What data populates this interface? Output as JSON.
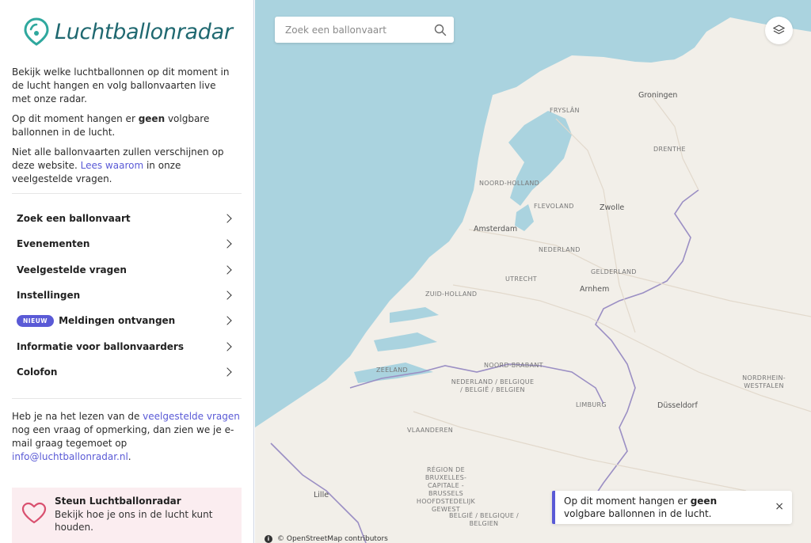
{
  "app": {
    "name": "Luchtballonradar"
  },
  "sidebar": {
    "intro_1": "Bekijk welke luchtballonnen op dit moment in de lucht hangen en volg ballonvaarten live met onze radar.",
    "intro_2_pre": "Op dit moment hangen er ",
    "intro_2_bold": "geen",
    "intro_2_post": " volgbare ballonnen in de lucht.",
    "intro_3_pre": "Niet alle ballonvaarten zullen verschijnen op deze website. ",
    "intro_3_link": "Lees waarom",
    "intro_3_post": " in onze veelgestelde vragen.",
    "menu": [
      {
        "label": "Zoek een ballonvaart"
      },
      {
        "label": "Evenementen"
      },
      {
        "label": "Veelgestelde vragen"
      },
      {
        "label": "Instellingen"
      },
      {
        "label": "Meldingen ontvangen",
        "badge": "NIEUW"
      },
      {
        "label": "Informatie voor ballonvaarders"
      },
      {
        "label": "Colofon"
      }
    ],
    "footer_pre": "Heb je na het lezen van de ",
    "footer_link": "veelgestelde vragen",
    "footer_mid": " nog een vraag of opmerking, dan zien we je e-mail graag tegemoet op ",
    "footer_email": "info@luchtballonradar.nl",
    "footer_post": ".",
    "support_title": "Steun Luchtballonradar",
    "support_sub": "Bekijk hoe je ons in de lucht kunt houden."
  },
  "map": {
    "search_placeholder": "Zoek een ballonvaart",
    "labels": {
      "fryslan": "FRYSLÂN",
      "groningen": "Groningen",
      "drenthe": "DRENTHE",
      "noord_holland": "NOORD-HOLLAND",
      "flevoland": "FLEVOLAND",
      "zwolle": "Zwolle",
      "amsterdam": "Amsterdam",
      "nederland": "NEDERLAND",
      "utrecht": "UTRECHT",
      "gelderland": "GELDERLAND",
      "zuid_holland": "ZUID-HOLLAND",
      "arnhem": "Arnhem",
      "zeeland": "ZEELAND",
      "noord_brabant": "NOORD-BRABANT",
      "nl_be_1": "NEDERLAND / BELGIQUE / BELGIË / BELGIEN",
      "limburg": "LIMBURG",
      "dusseldorf": "Düsseldorf",
      "nrw": "NORDRHEIN-WESTFALEN",
      "vlaanderen": "VLAANDEREN",
      "brussels": "RÉGION DE BRUXELLES-CAPITALE - BRUSSELS HOOFDSTEDELIJK GEWEST",
      "lille": "Lille",
      "be_2": "BELGIË / BELGIQUE / BELGIEN"
    },
    "attribution": "© OpenStreetMap contributors",
    "toast_pre": "Op dit moment hangen er ",
    "toast_bold": "geen",
    "toast_post": " volgbare ballonnen in de lucht.",
    "toast_close": "×"
  },
  "colors": {
    "accent": "#5a5ad6",
    "logo": "#1f6870",
    "water": "#aad3df",
    "land": "#f2efe9",
    "border": "#9b8fc4"
  }
}
